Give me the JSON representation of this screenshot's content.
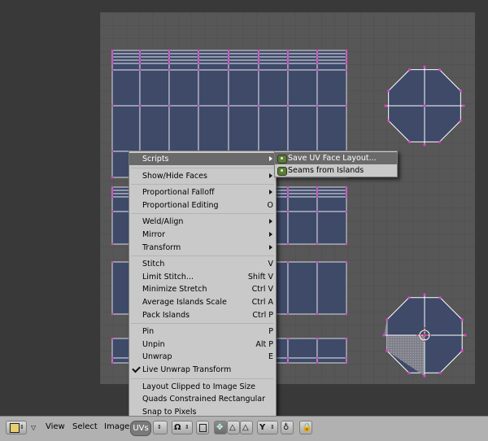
{
  "menu": {
    "items": [
      {
        "label": "Scripts",
        "shortcut": "",
        "submenu": true,
        "highlight": true,
        "check": false
      },
      {
        "sep": true
      },
      {
        "label": "Show/Hide Faces",
        "shortcut": "",
        "submenu": true,
        "check": false
      },
      {
        "sep": true
      },
      {
        "label": "Proportional Falloff",
        "shortcut": "",
        "submenu": true,
        "check": false
      },
      {
        "label": "Proportional Editing",
        "shortcut": "O",
        "submenu": false,
        "check": false
      },
      {
        "sep": true
      },
      {
        "label": "Weld/Align",
        "shortcut": "",
        "submenu": true,
        "check": false
      },
      {
        "label": "Mirror",
        "shortcut": "",
        "submenu": true,
        "check": false
      },
      {
        "label": "Transform",
        "shortcut": "",
        "submenu": true,
        "check": false
      },
      {
        "sep": true
      },
      {
        "label": "Stitch",
        "shortcut": "V",
        "submenu": false,
        "check": false
      },
      {
        "label": "Limit Stitch...",
        "shortcut": "Shift V",
        "submenu": false,
        "check": false
      },
      {
        "label": "Minimize Stretch",
        "shortcut": "Ctrl V",
        "submenu": false,
        "check": false
      },
      {
        "label": "Average Islands Scale",
        "shortcut": "Ctrl A",
        "submenu": false,
        "check": false
      },
      {
        "label": "Pack Islands",
        "shortcut": "Ctrl P",
        "submenu": false,
        "check": false
      },
      {
        "sep": true
      },
      {
        "label": "Pin",
        "shortcut": "P",
        "submenu": false,
        "check": false
      },
      {
        "label": "Unpin",
        "shortcut": "Alt P",
        "submenu": false,
        "check": false
      },
      {
        "label": "Unwrap",
        "shortcut": "E",
        "submenu": false,
        "check": false
      },
      {
        "label": "Live Unwrap Transform",
        "shortcut": "",
        "submenu": false,
        "check": true
      },
      {
        "sep": true
      },
      {
        "label": "Layout Clipped to Image Size",
        "shortcut": "",
        "submenu": false,
        "check": false
      },
      {
        "label": "Quads Constrained Rectangular",
        "shortcut": "",
        "submenu": false,
        "check": false
      },
      {
        "label": "Snap to Pixels",
        "shortcut": "",
        "submenu": false,
        "check": false
      }
    ]
  },
  "submenu": {
    "items": [
      {
        "label": "Save UV Face Layout...",
        "highlight": true
      },
      {
        "label": "Seams from Islands",
        "highlight": false
      }
    ]
  },
  "header": {
    "editor_type_icon": "uv-editor-icon",
    "menus": [
      "View",
      "Select",
      "Image",
      "UVs"
    ],
    "colors": {
      "header_bg": "#b1b1b1",
      "viewport_bg": "#393939",
      "grid_bg": "#555555",
      "face_fill": "#3e4a68",
      "edge": "#ffffff",
      "vertex": "#e040d0"
    }
  }
}
